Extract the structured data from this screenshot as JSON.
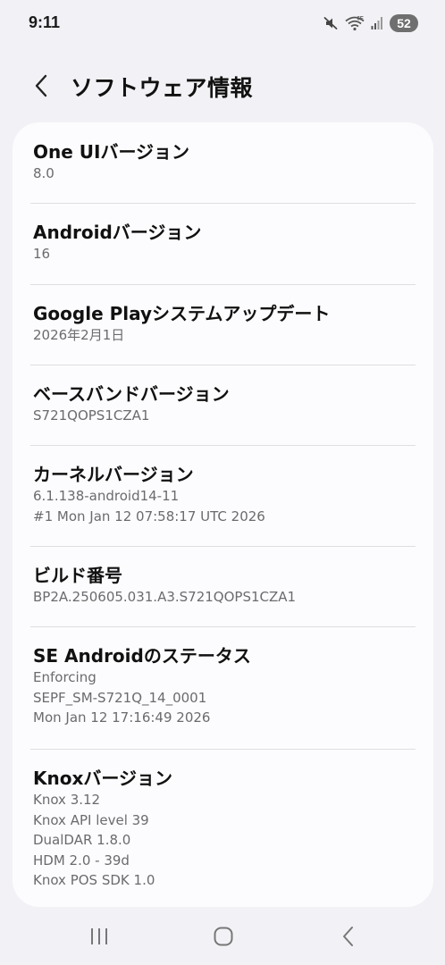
{
  "status_bar": {
    "time": "9:11",
    "battery": "52",
    "icons": [
      "mute-icon",
      "wifi-6e-icon",
      "cellular-signal-icon",
      "battery-icon"
    ]
  },
  "header": {
    "title": "ソフトウェア情報",
    "back_icon": "chevron-left-icon"
  },
  "items": [
    {
      "title": "One UIバージョン",
      "values": [
        "8.0"
      ]
    },
    {
      "title": "Androidバージョン",
      "values": [
        "16"
      ]
    },
    {
      "title": "Google Playシステムアップデート",
      "values": [
        "2026年2月1日"
      ]
    },
    {
      "title": "ベースバンドバージョン",
      "values": [
        "S721QOPS1CZA1"
      ]
    },
    {
      "title": "カーネルバージョン",
      "values": [
        "6.1.138-android14-11",
        "#1 Mon Jan 12 07:58:17 UTC 2026"
      ]
    },
    {
      "title": "ビルド番号",
      "values": [
        "BP2A.250605.031.A3.S721QOPS1CZA1"
      ]
    },
    {
      "title": "SE Androidのステータス",
      "values": [
        "Enforcing",
        "SEPF_SM-S721Q_14_0001",
        "Mon Jan 12 17:16:49 2026"
      ]
    },
    {
      "title": "Knoxバージョン",
      "values": [
        "Knox 3.12",
        "Knox API level 39",
        "DualDAR 1.8.0",
        "HDM 2.0 - 39d",
        "Knox POS SDK 1.0"
      ]
    }
  ],
  "nav_bar": {
    "icons": [
      "recents-icon",
      "home-icon",
      "back-icon"
    ]
  },
  "colors": {
    "background": "#f2f2f6",
    "card": "#fcfcfe",
    "title_text": "#111111",
    "value_text": "#6b6b6e",
    "divider": "#dedee2"
  }
}
